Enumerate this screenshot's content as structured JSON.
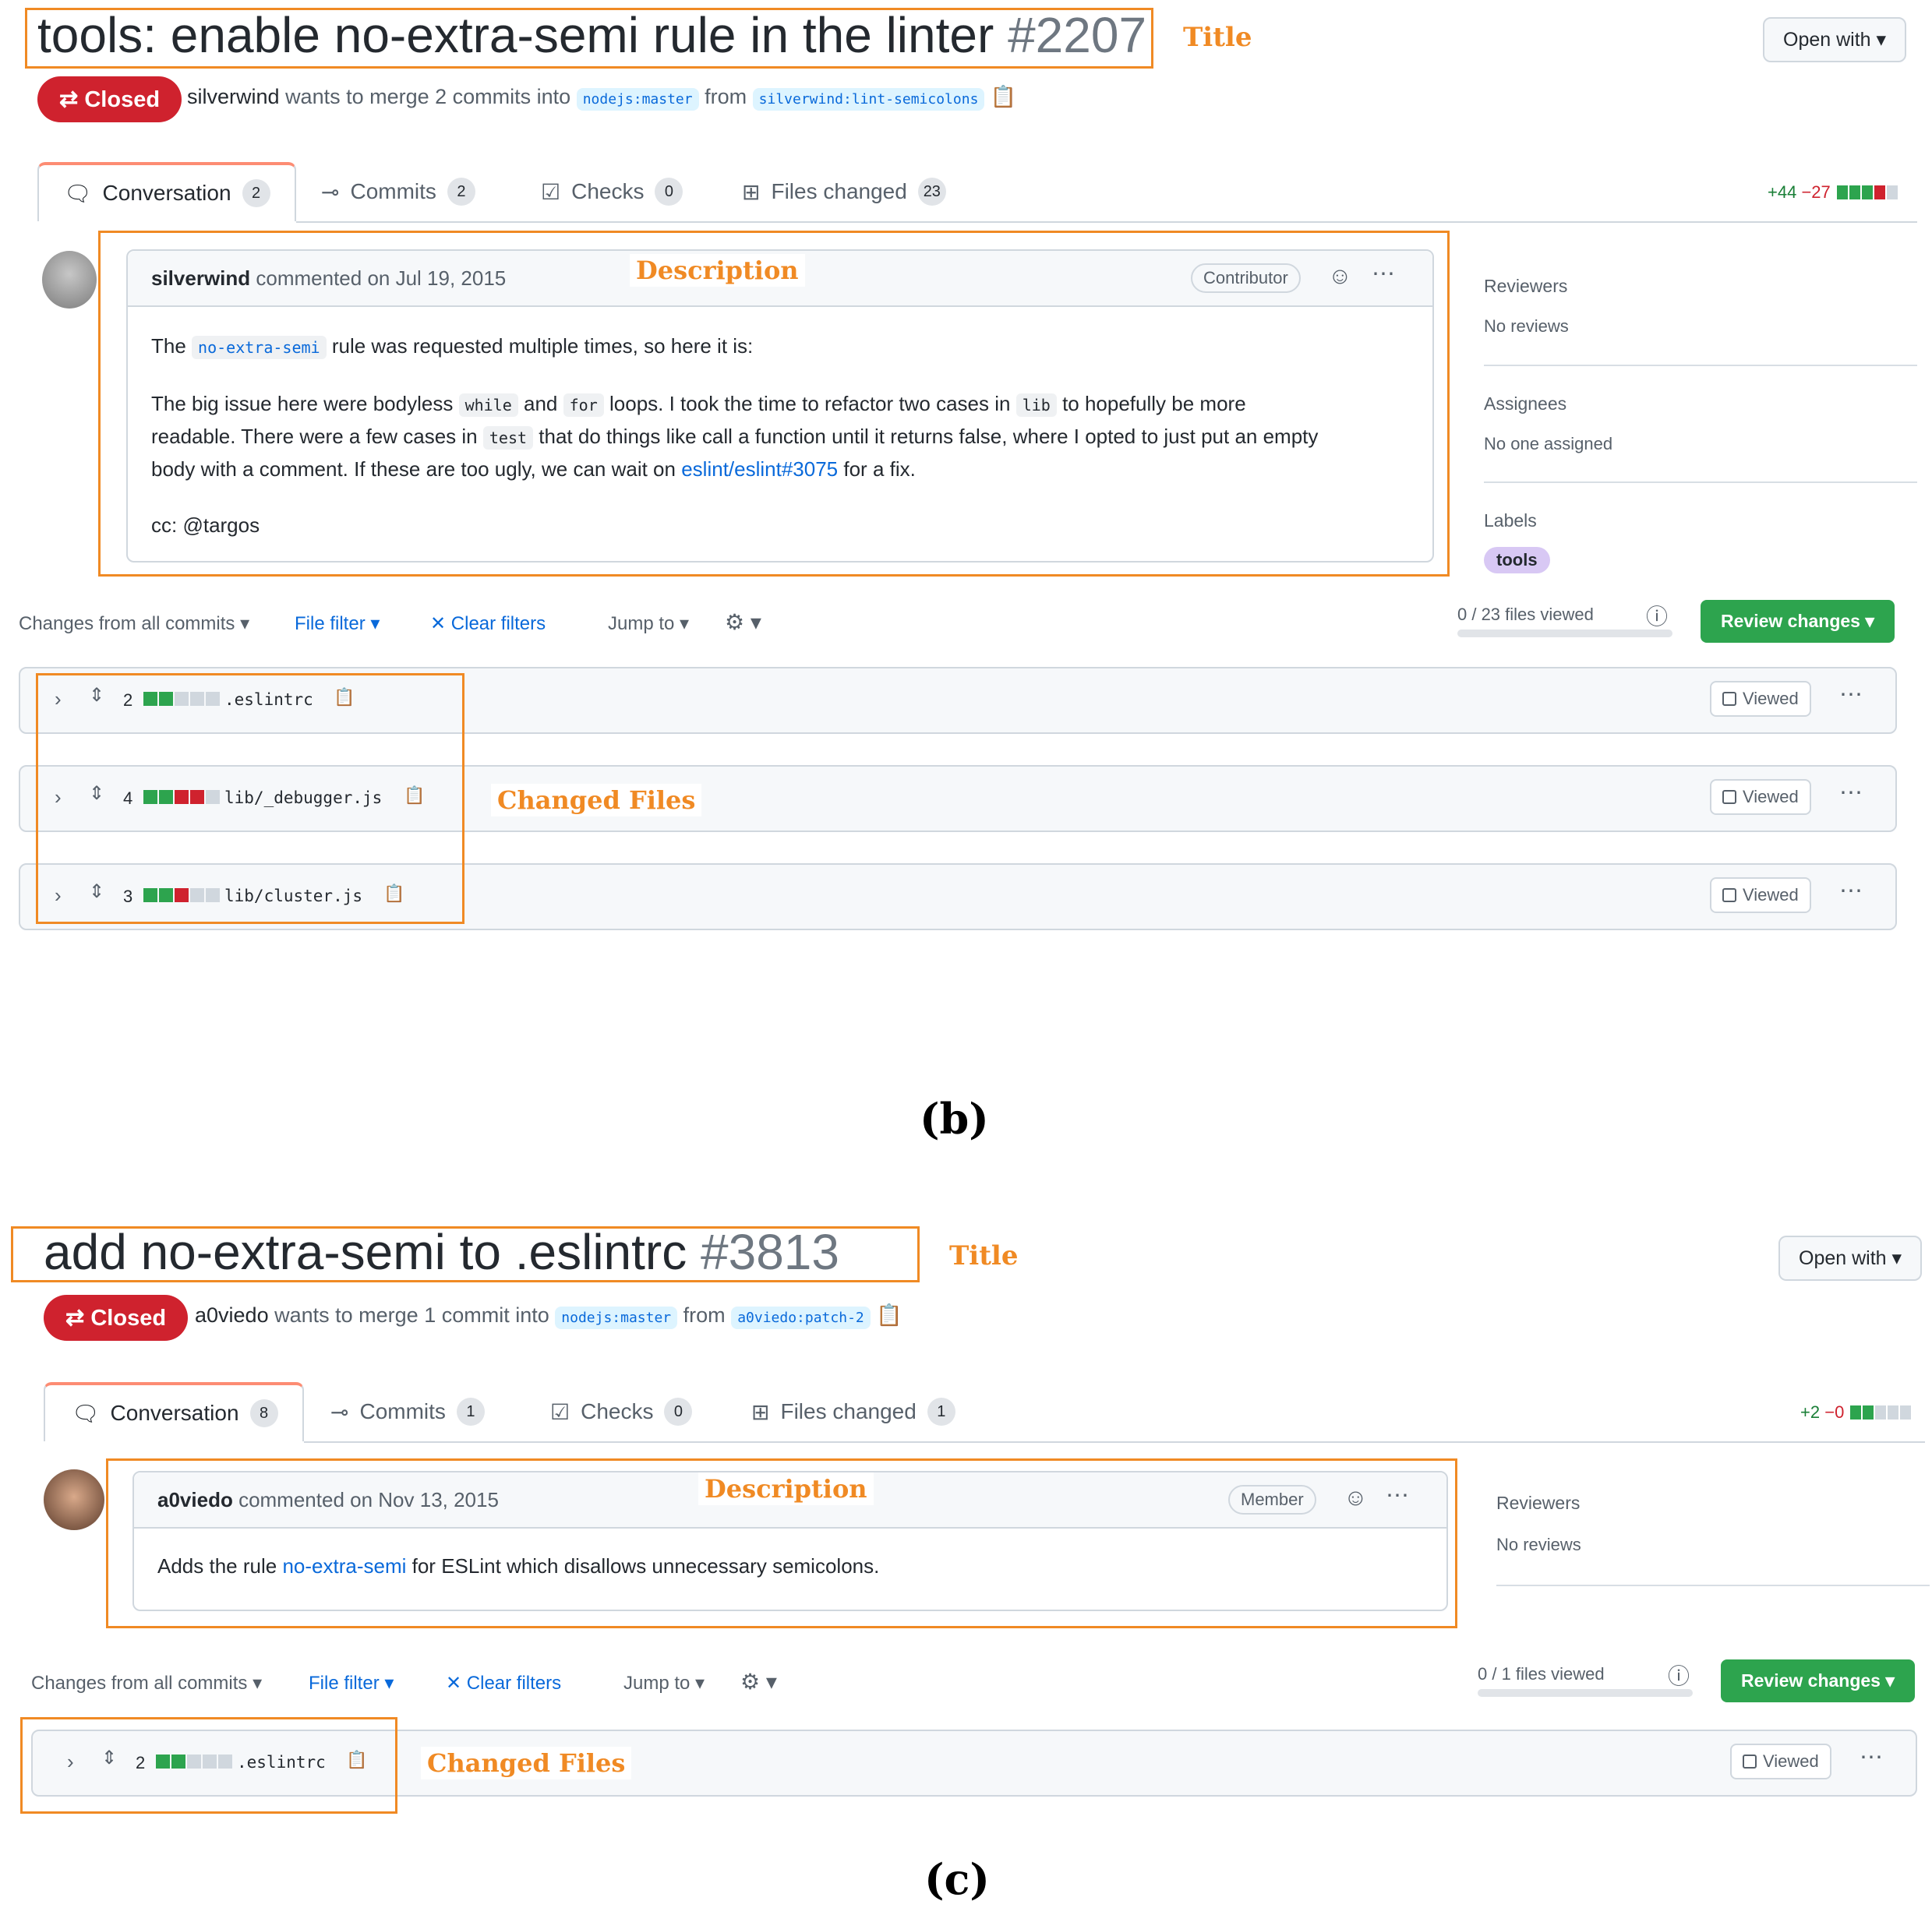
{
  "panel_b": {
    "title": "tools: enable no-extra-semi rule in the linter",
    "number": "#2207",
    "annot_title": "Title",
    "open_with": "Open with ▾",
    "status": "Closed",
    "meta_user": "silverwind",
    "meta_text": "wants to merge 2 commits into",
    "base_branch": "nodejs:master",
    "from": "from",
    "head_branch": "silverwind:lint-semicolons",
    "tabs": [
      {
        "label": "Conversation",
        "count": "2"
      },
      {
        "label": "Commits",
        "count": "2"
      },
      {
        "label": "Checks",
        "count": "0"
      },
      {
        "label": "Files changed",
        "count": "23"
      }
    ],
    "diff_add": "+44",
    "diff_del": "−27",
    "comment_user": "silverwind",
    "comment_time": "commented on Jul 19, 2015",
    "annot_description": "Description",
    "role": "Contributor",
    "body_p1_a": "The",
    "body_p1_code": "no-extra-semi",
    "body_p1_b": "rule was requested multiple times, so here it is:",
    "body_p2_a": "The big issue here were bodyless",
    "body_p2_code1": "while",
    "body_p2_and": "and",
    "body_p2_code2": "for",
    "body_p2_b": "loops. I took the time to refactor two cases in",
    "body_p2_code3": "lib",
    "body_p2_c": "to hopefully be more",
    "body_p2_d": "readable. There were a few cases in",
    "body_p2_code4": "test",
    "body_p2_e": "that do things like call a function until it returns false, where I opted to just put an empty",
    "body_p2_f": "body with a comment. If these are too ugly, we can wait on",
    "body_p2_link": "eslint/eslint#3075",
    "body_p2_g": "for a fix.",
    "body_p3": "cc: @targos",
    "sidebar": {
      "reviewers": "Reviewers",
      "reviewers_val": "No reviews",
      "assignees": "Assignees",
      "assignees_val": "No one assigned",
      "labels": "Labels",
      "label_val": "tools"
    },
    "toolbar": {
      "changes": "Changes from all commits ▾",
      "file_filter": "File filter ▾",
      "clear": "✕ Clear filters",
      "jump": "Jump to ▾",
      "gear": "⚙ ▾"
    },
    "files_viewed": "0 / 23 files viewed",
    "review_btn": "Review changes ▾",
    "files": [
      {
        "num": "2",
        "name": ".eslintrc"
      },
      {
        "num": "4",
        "name": "lib/_debugger.js"
      },
      {
        "num": "3",
        "name": "lib/cluster.js"
      }
    ],
    "viewed": "Viewed",
    "annot_files": "Changed Files",
    "caption": "(b)"
  },
  "panel_c": {
    "title": "add no-extra-semi to .eslintrc",
    "number": "#3813",
    "annot_title": "Title",
    "open_with": "Open with ▾",
    "status": "Closed",
    "meta_user": "a0viedo",
    "meta_text": "wants to merge 1 commit into",
    "base_branch": "nodejs:master",
    "from": "from",
    "head_branch": "a0viedo:patch-2",
    "tabs": [
      {
        "label": "Conversation",
        "count": "8"
      },
      {
        "label": "Commits",
        "count": "1"
      },
      {
        "label": "Checks",
        "count": "0"
      },
      {
        "label": "Files changed",
        "count": "1"
      }
    ],
    "diff_add": "+2",
    "diff_del": "−0",
    "comment_user": "a0viedo",
    "comment_time": "commented on Nov 13, 2015",
    "annot_description": "Description",
    "role": "Member",
    "body_a": "Adds the rule",
    "body_link": "no-extra-semi",
    "body_b": "for ESLint which disallows unnecessary semicolons.",
    "sidebar": {
      "reviewers": "Reviewers",
      "reviewers_val": "No reviews"
    },
    "toolbar": {
      "changes": "Changes from all commits ▾",
      "file_filter": "File filter ▾",
      "clear": "✕ Clear filters",
      "jump": "Jump to ▾",
      "gear": "⚙ ▾"
    },
    "files_viewed": "0 / 1 files viewed",
    "review_btn": "Review changes ▾",
    "files": [
      {
        "num": "2",
        "name": ".eslintrc"
      }
    ],
    "viewed": "Viewed",
    "annot_files": "Changed Files",
    "caption": "(c)"
  }
}
